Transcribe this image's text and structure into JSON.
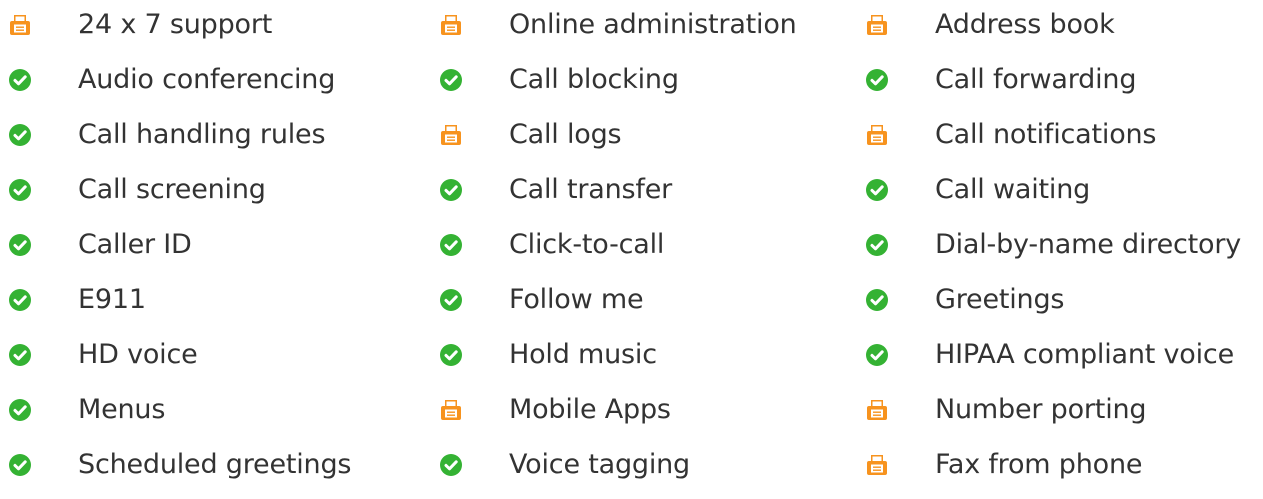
{
  "colors": {
    "check": "#34b233",
    "fax": "#f7931e",
    "text": "#333333"
  },
  "columns": [
    [
      {
        "label": "24 x 7 support",
        "icon": "fax-icon"
      },
      {
        "label": "Audio conferencing",
        "icon": "check-icon"
      },
      {
        "label": "Call handling rules",
        "icon": "check-icon"
      },
      {
        "label": "Call screening",
        "icon": "check-icon"
      },
      {
        "label": "Caller ID",
        "icon": "check-icon"
      },
      {
        "label": "E911",
        "icon": "check-icon"
      },
      {
        "label": "HD voice",
        "icon": "check-icon"
      },
      {
        "label": "Menus",
        "icon": "check-icon"
      },
      {
        "label": "Scheduled greetings",
        "icon": "check-icon"
      }
    ],
    [
      {
        "label": "Online administration",
        "icon": "fax-icon"
      },
      {
        "label": "Call blocking",
        "icon": "check-icon"
      },
      {
        "label": "Call logs",
        "icon": "fax-icon"
      },
      {
        "label": "Call transfer",
        "icon": "check-icon"
      },
      {
        "label": "Click-to-call",
        "icon": "check-icon"
      },
      {
        "label": "Follow me",
        "icon": "check-icon"
      },
      {
        "label": "Hold music",
        "icon": "check-icon"
      },
      {
        "label": "Mobile Apps",
        "icon": "fax-icon"
      },
      {
        "label": "Voice tagging",
        "icon": "check-icon"
      }
    ],
    [
      {
        "label": "Address book",
        "icon": "fax-icon"
      },
      {
        "label": "Call forwarding",
        "icon": "check-icon"
      },
      {
        "label": "Call notifications",
        "icon": "fax-icon"
      },
      {
        "label": "Call waiting",
        "icon": "check-icon"
      },
      {
        "label": "Dial-by-name directory",
        "icon": "check-icon"
      },
      {
        "label": "Greetings",
        "icon": "check-icon"
      },
      {
        "label": "HIPAA compliant voice",
        "icon": "check-icon"
      },
      {
        "label": "Number porting",
        "icon": "fax-icon"
      },
      {
        "label": "Fax from phone",
        "icon": "fax-icon"
      }
    ]
  ]
}
